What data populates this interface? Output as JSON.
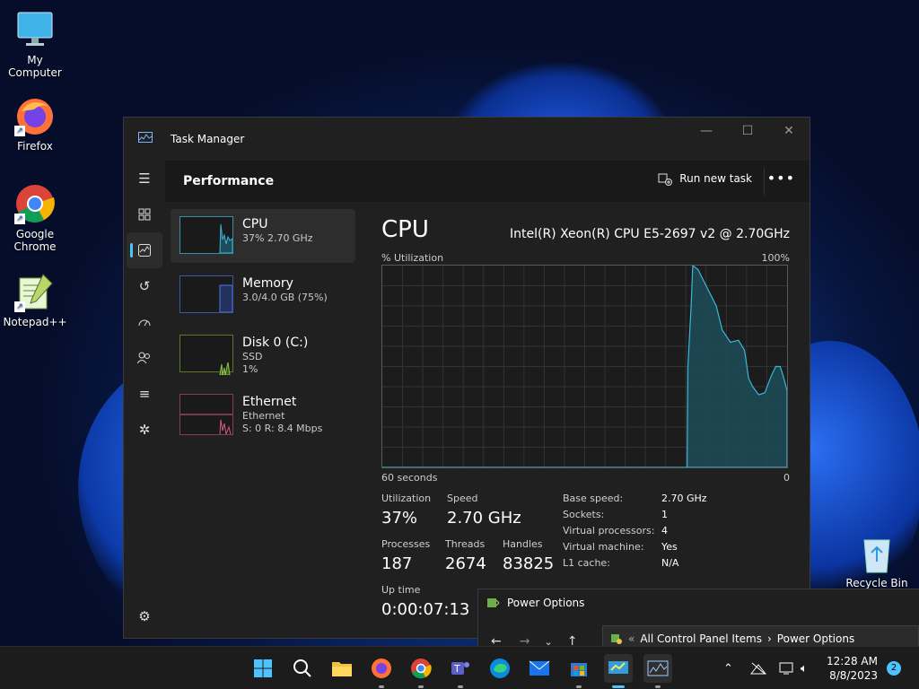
{
  "desktop": {
    "icons": [
      {
        "label": "My Computer",
        "icon": "computer-icon"
      },
      {
        "label": "Firefox",
        "icon": "firefox-icon"
      },
      {
        "label": "Google Chrome",
        "icon": "chrome-icon"
      },
      {
        "label": "Notepad++",
        "icon": "notepadpp-icon"
      }
    ],
    "recycle_bin": "Recycle Bin"
  },
  "task_manager": {
    "title": "Task Manager",
    "page_title": "Performance",
    "run_new_task": "Run new task",
    "more": "•••",
    "side_items": [
      {
        "name": "CPU",
        "line1": "37% 2.70 GHz",
        "line2": ""
      },
      {
        "name": "Memory",
        "line1": "3.0/4.0 GB (75%)",
        "line2": ""
      },
      {
        "name": "Disk 0 (C:)",
        "line1": "SSD",
        "line2": "1%"
      },
      {
        "name": "Ethernet",
        "line1": "Ethernet",
        "line2": "S: 0 R: 8.4 Mbps"
      }
    ],
    "cpu": {
      "title": "CPU",
      "model": "Intel(R) Xeon(R) CPU E5-2697 v2 @ 2.70GHz",
      "util_label": "% Utilization",
      "max_label": "100%",
      "left_axis": "60 seconds",
      "right_axis": "0",
      "stats": {
        "utilization_label": "Utilization",
        "utilization": "37%",
        "speed_label": "Speed",
        "speed": "2.70 GHz",
        "processes_label": "Processes",
        "processes": "187",
        "threads_label": "Threads",
        "threads": "2674",
        "handles_label": "Handles",
        "handles": "83825",
        "uptime_label": "Up time",
        "uptime": "0:00:07:13"
      },
      "specs": [
        {
          "k": "Base speed:",
          "v": "2.70 GHz"
        },
        {
          "k": "Sockets:",
          "v": "1"
        },
        {
          "k": "Virtual processors:",
          "v": "4"
        },
        {
          "k": "Virtual machine:",
          "v": "Yes"
        },
        {
          "k": "L1 cache:",
          "v": "N/A"
        }
      ],
      "graph_series": [
        0,
        0,
        0,
        0,
        0,
        0,
        0,
        0,
        0,
        0,
        0,
        0,
        0,
        0,
        0,
        0,
        0,
        0,
        0,
        0,
        0,
        0,
        0,
        0,
        0,
        0,
        0,
        0,
        0,
        0,
        0,
        0,
        0,
        0,
        0,
        0,
        0,
        0,
        0,
        0,
        0,
        0,
        0,
        0,
        0,
        0,
        0,
        0,
        0,
        0,
        0,
        0,
        0,
        0,
        0,
        0,
        0,
        0,
        0,
        0,
        0,
        0,
        0,
        0,
        0,
        0,
        0,
        0,
        0,
        0,
        0,
        0,
        0,
        0,
        0,
        0,
        0,
        0,
        0,
        0,
        0,
        0,
        0,
        0,
        0,
        0,
        0,
        0,
        0,
        0,
        0,
        0,
        0,
        0,
        0,
        0,
        0,
        0,
        0,
        0,
        0,
        0,
        0,
        0,
        0,
        0,
        0,
        0,
        0,
        0,
        0,
        0,
        0,
        0,
        0,
        0,
        0,
        0,
        0,
        0,
        0,
        0,
        0,
        0,
        0,
        0,
        0,
        0,
        0,
        0,
        0,
        0,
        0,
        0,
        0,
        0,
        0,
        0,
        0,
        0,
        0,
        0,
        0,
        0,
        0,
        0,
        0,
        0,
        0,
        0,
        0,
        0,
        0,
        0,
        0,
        0,
        0,
        0,
        0,
        0,
        0,
        0,
        0,
        0,
        0,
        0,
        0,
        0,
        0,
        0,
        0,
        0,
        0,
        0,
        0,
        0,
        0,
        0,
        0,
        0,
        0,
        0,
        0,
        0,
        0,
        0,
        0,
        0,
        0,
        0,
        0,
        0,
        0,
        0,
        0,
        0,
        0,
        0,
        0,
        0
      ]
    }
  },
  "power_options": {
    "title": "Power Options",
    "path_prefix": "«",
    "path1": "All Control Panel Items",
    "sep": "›",
    "path2": "Power Options"
  },
  "taskbar": {
    "clock_time": "12:28 AM",
    "clock_date": "8/8/2023",
    "notifications": "2"
  }
}
